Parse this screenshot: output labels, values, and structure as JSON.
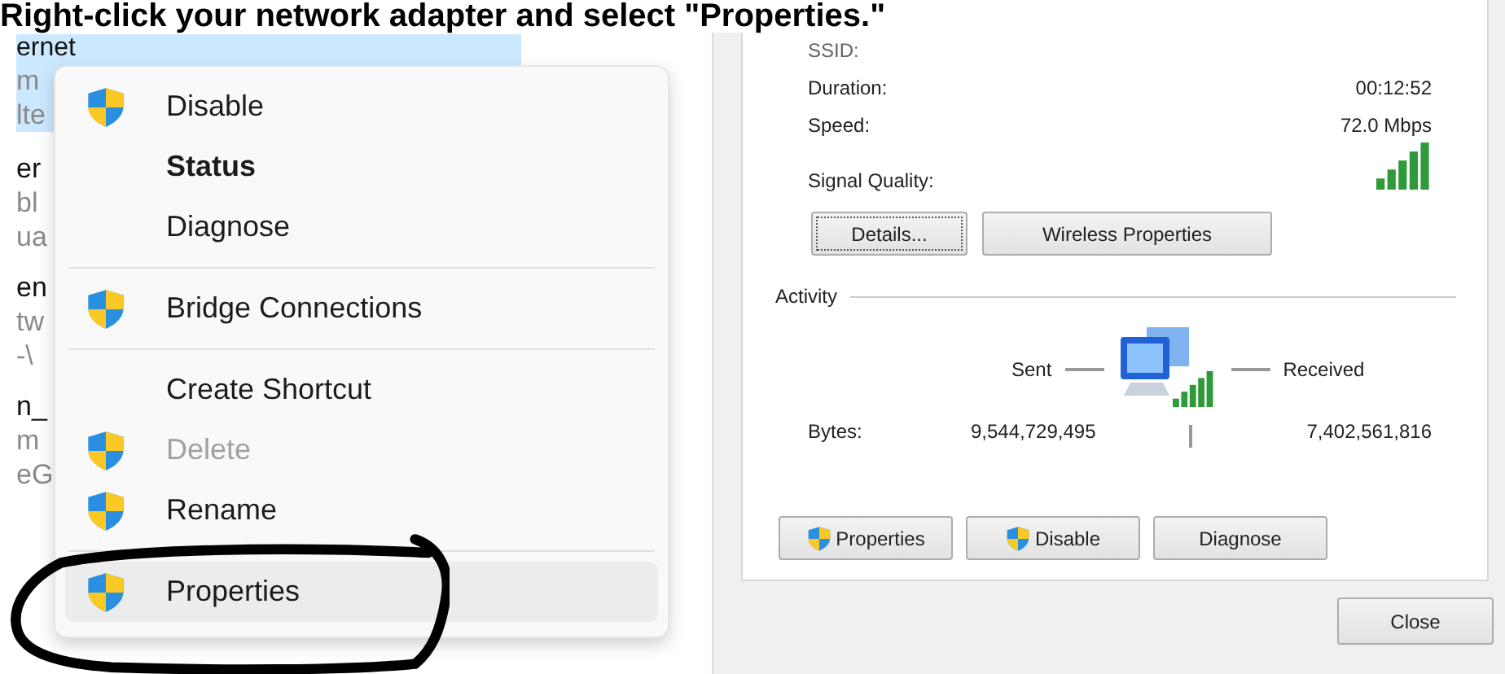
{
  "heading": "Right-click your network adapter and select \"Properties.\"",
  "background_list": [
    {
      "text": "ernet",
      "kind": "name",
      "selected": true
    },
    {
      "text": "m",
      "kind": "detail",
      "selected": true
    },
    {
      "text": "lte",
      "kind": "detail",
      "selected": true
    },
    {
      "text": "er",
      "kind": "name",
      "selected": false
    },
    {
      "text": "bl",
      "kind": "detail",
      "selected": false
    },
    {
      "text": "ua",
      "kind": "detail",
      "selected": false
    },
    {
      "text": "en",
      "kind": "name",
      "selected": false
    },
    {
      "text": "tw",
      "kind": "detail",
      "selected": false
    },
    {
      "text": "-\\",
      "kind": "detail",
      "selected": false
    },
    {
      "text": "n_",
      "kind": "name",
      "selected": false
    },
    {
      "text": "m",
      "kind": "detail",
      "selected": false
    },
    {
      "text": "eG",
      "kind": "detail",
      "selected": false
    }
  ],
  "context_menu": [
    {
      "kind": "item",
      "label": "Disable",
      "shield": true,
      "bold": false,
      "disabled": false,
      "selected": false
    },
    {
      "kind": "item",
      "label": "Status",
      "shield": false,
      "bold": true,
      "disabled": false,
      "selected": false
    },
    {
      "kind": "item",
      "label": "Diagnose",
      "shield": false,
      "bold": false,
      "disabled": false,
      "selected": false
    },
    {
      "kind": "separator"
    },
    {
      "kind": "item",
      "label": "Bridge Connections",
      "shield": true,
      "bold": false,
      "disabled": false,
      "selected": false
    },
    {
      "kind": "separator"
    },
    {
      "kind": "item",
      "label": "Create Shortcut",
      "shield": false,
      "bold": false,
      "disabled": false,
      "selected": false
    },
    {
      "kind": "item",
      "label": "Delete",
      "shield": true,
      "bold": false,
      "disabled": true,
      "selected": false
    },
    {
      "kind": "item",
      "label": "Rename",
      "shield": true,
      "bold": false,
      "disabled": false,
      "selected": false
    },
    {
      "kind": "separator"
    },
    {
      "kind": "item",
      "label": "Properties",
      "shield": true,
      "bold": false,
      "disabled": false,
      "selected": true
    }
  ],
  "status_dialog": {
    "rows": [
      {
        "kind": "text",
        "label": "SSID:"
      },
      {
        "kind": "text",
        "label": "Duration:",
        "value": "00:12:52"
      },
      {
        "kind": "text",
        "label": "Speed:",
        "value": "72.0 Mbps"
      },
      {
        "kind": "signal",
        "label": "Signal Quality:"
      }
    ],
    "connection_buttons": [
      {
        "label": "Details...",
        "focused": true
      },
      {
        "label": "Wireless Properties",
        "focused": false
      }
    ],
    "activity": {
      "title": "Activity",
      "sent_label": "Sent",
      "received_label": "Received",
      "bytes_label": "Bytes:",
      "bytes_sent": "9,544,729,495",
      "bytes_received": "7,402,561,816"
    },
    "action_buttons": [
      {
        "label": "Properties",
        "shield": true
      },
      {
        "label": "Disable",
        "shield": true
      },
      {
        "label": "Diagnose",
        "shield": false
      }
    ],
    "close_button": "Close"
  }
}
